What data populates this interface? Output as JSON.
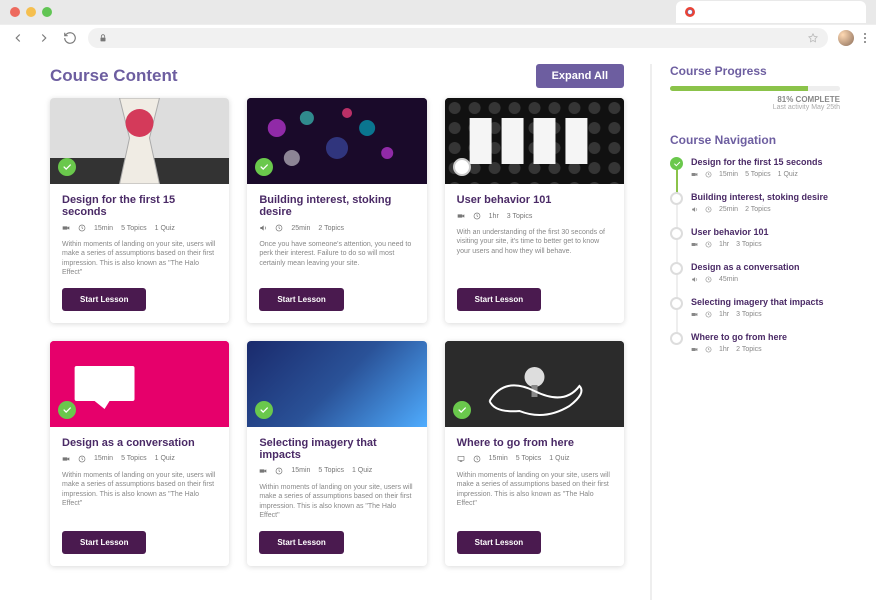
{
  "header": {
    "title": "Course Content",
    "expand_label": "Expand All"
  },
  "cards": [
    {
      "title": "Design for the first 15 seconds",
      "media": "video",
      "duration": "15min",
      "topics": "5 Topics",
      "quiz": "1 Quiz",
      "desc": "Within moments of landing on your site, users will make a series of assumptions based on their first impression. This is also known as \"The Halo Effect\"",
      "btn": "Start Lesson",
      "done": true,
      "thumb": "thumb0"
    },
    {
      "title": "Building interest, stoking desire",
      "media": "audio",
      "duration": "25min",
      "topics": "2 Topics",
      "quiz": "",
      "desc": "Once you have someone's attention, you need to perk their interest. Failure to do so will most certainly mean leaving your site.",
      "btn": "Start Lesson",
      "done": true,
      "thumb": "thumb1"
    },
    {
      "title": "User behavior 101",
      "media": "video",
      "duration": "1hr",
      "topics": "3 Topics",
      "quiz": "",
      "desc": "With an understanding of the first 30 seconds of visiting your site, it's time to better get to know your users and how they will behave.",
      "btn": "Start Lesson",
      "done": false,
      "thumb": "thumb2"
    },
    {
      "title": "Design as a conversation",
      "media": "video",
      "duration": "15min",
      "topics": "5 Topics",
      "quiz": "1 Quiz",
      "desc": "Within moments of landing on your site, users will make a series of assumptions based on their first impression. This is also known as \"The Halo Effect\"",
      "btn": "Start Lesson",
      "done": true,
      "thumb": "thumb3"
    },
    {
      "title": "Selecting imagery that impacts",
      "media": "video",
      "duration": "15min",
      "topics": "5 Topics",
      "quiz": "1 Quiz",
      "desc": "Within moments of landing on your site, users will make a series of assumptions based on their first impression. This is also known as \"The Halo Effect\"",
      "btn": "Start Lesson",
      "done": true,
      "thumb": "thumb4"
    },
    {
      "title": "Where to go from here",
      "media": "screen",
      "duration": "15min",
      "topics": "5 Topics",
      "quiz": "1 Quiz",
      "desc": "Within moments of landing on your site, users will make a series of assumptions based on their first impression. This is also known as \"The Halo Effect\"",
      "btn": "Start Lesson",
      "done": true,
      "thumb": "thumb5"
    }
  ],
  "progress": {
    "title": "Course Progress",
    "pct": 81,
    "pct_label": "81% COMPLETE",
    "last": "Last activity May 25th"
  },
  "nav": {
    "title": "Course Navigation",
    "items": [
      {
        "title": "Design for the first 15 seconds",
        "media": "video",
        "duration": "15min",
        "topics": "5 Topics",
        "quiz": "1 Quiz",
        "done": true
      },
      {
        "title": "Building interest, stoking desire",
        "media": "audio",
        "duration": "25min",
        "topics": "2 Topics",
        "quiz": "",
        "done": false
      },
      {
        "title": "User behavior 101",
        "media": "video",
        "duration": "1hr",
        "topics": "3 Topics",
        "quiz": "",
        "done": false
      },
      {
        "title": "Design as a conversation",
        "media": "audio",
        "duration": "45min",
        "topics": "",
        "quiz": "",
        "done": false
      },
      {
        "title": "Selecting imagery that impacts",
        "media": "video",
        "duration": "1hr",
        "topics": "3 Topics",
        "quiz": "",
        "done": false
      },
      {
        "title": "Where to go from here",
        "media": "video",
        "duration": "1hr",
        "topics": "2 Topics",
        "quiz": "",
        "done": false
      }
    ]
  }
}
